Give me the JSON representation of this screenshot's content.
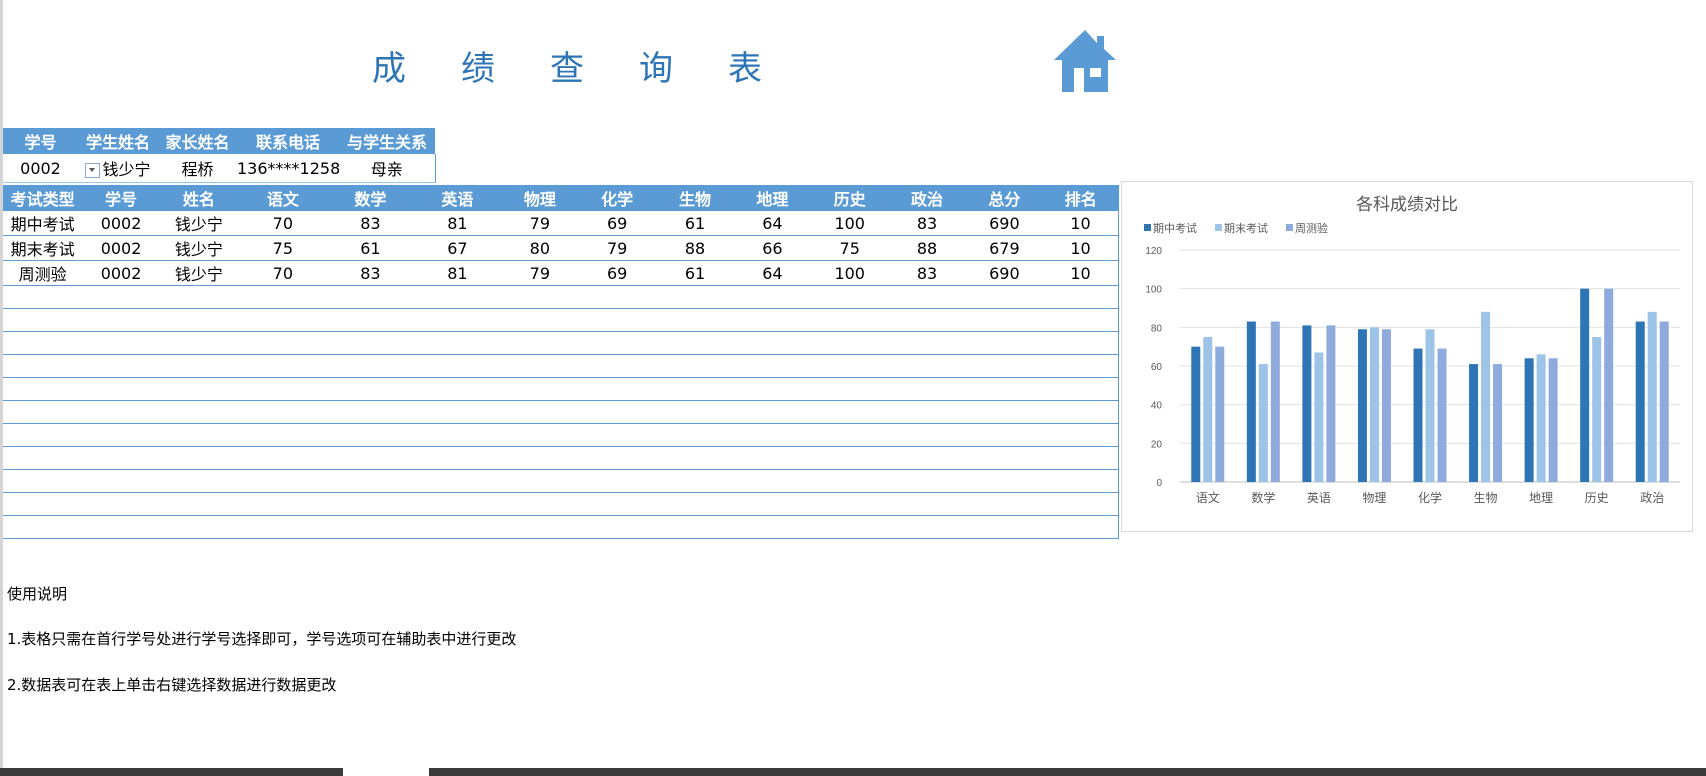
{
  "title_chars": [
    "成",
    "绩",
    "查",
    "询",
    "表"
  ],
  "info": {
    "headers": [
      "学号",
      "学生姓名",
      "家长姓名",
      "联系电话",
      "与学生关系"
    ],
    "row": [
      "0002",
      "钱少宁",
      "程桥",
      "136****1258",
      "母亲"
    ]
  },
  "scores": {
    "headers": [
      "考试类型",
      "学号",
      "姓名",
      "语文",
      "数学",
      "英语",
      "物理",
      "化学",
      "生物",
      "地理",
      "历史",
      "政治",
      "总分",
      "排名"
    ],
    "rows": [
      [
        "期中考试",
        "0002",
        "钱少宁",
        "70",
        "83",
        "81",
        "79",
        "69",
        "61",
        "64",
        "100",
        "83",
        "690",
        "10"
      ],
      [
        "期末考试",
        "0002",
        "钱少宁",
        "75",
        "61",
        "67",
        "80",
        "79",
        "88",
        "66",
        "75",
        "88",
        "679",
        "10"
      ],
      [
        "周测验",
        "0002",
        "钱少宁",
        "70",
        "83",
        "81",
        "79",
        "69",
        "61",
        "64",
        "100",
        "83",
        "690",
        "10"
      ]
    ]
  },
  "notes": {
    "heading": "使用说明",
    "line1": "1.表格只需在首行学号处进行学号选择即可，学号选项可在辅助表中进行更改",
    "line2": "2.数据表可在表上单击右键选择数据进行数据更改"
  },
  "chart_data": {
    "type": "bar",
    "title": "各科成绩对比",
    "categories": [
      "语文",
      "数学",
      "英语",
      "物理",
      "化学",
      "生物",
      "地理",
      "历史",
      "政治"
    ],
    "series": [
      {
        "name": "期中考试",
        "values": [
          70,
          83,
          81,
          79,
          69,
          61,
          64,
          100,
          83
        ],
        "color": "#2E75B6"
      },
      {
        "name": "期末考试",
        "values": [
          75,
          61,
          67,
          80,
          79,
          88,
          66,
          75,
          88
        ],
        "color": "#9DC3E6"
      },
      {
        "name": "周测验",
        "values": [
          70,
          83,
          81,
          79,
          69,
          61,
          64,
          100,
          83
        ],
        "color": "#8FAADC"
      }
    ],
    "yticks": [
      0,
      20,
      40,
      60,
      80,
      100,
      120
    ],
    "ylim": [
      0,
      120
    ],
    "grid": true,
    "legend": "top-left"
  }
}
